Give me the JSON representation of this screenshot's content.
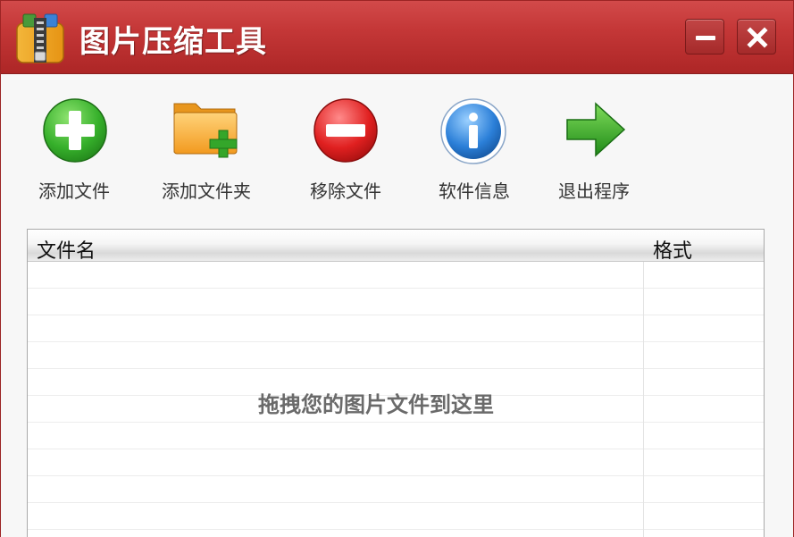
{
  "window": {
    "title": "图片压缩工具",
    "accent_color": "#c43737",
    "icon": "zipper-archive-icon"
  },
  "controls": {
    "minimize_icon": "minimize-icon",
    "close_icon": "close-icon"
  },
  "toolbar": {
    "items": [
      {
        "label": "添加文件",
        "icon": "plus-circle-icon"
      },
      {
        "label": "添加文件夹",
        "icon": "folder-add-icon"
      },
      {
        "label": "移除文件",
        "icon": "minus-circle-icon"
      },
      {
        "label": "软件信息",
        "icon": "info-circle-icon"
      },
      {
        "label": "退出程序",
        "icon": "arrow-right-icon"
      }
    ]
  },
  "file_list": {
    "columns": [
      "文件名",
      "格式"
    ],
    "rows": [],
    "empty_hint": "拖拽您的图片文件到这里"
  }
}
